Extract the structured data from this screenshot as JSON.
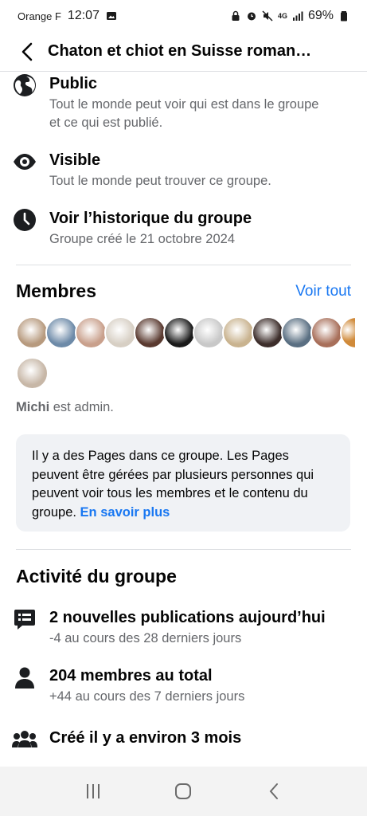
{
  "status_bar": {
    "carrier": "Orange F",
    "time": "12:07",
    "network": "4G",
    "battery": "69%"
  },
  "header": {
    "title": "Chaton et chiot en Suisse roman…"
  },
  "info": [
    {
      "icon": "globe-icon",
      "title": "Public",
      "sub": "Tout le monde peut voir qui est dans le groupe et ce qui est publié."
    },
    {
      "icon": "eye-icon",
      "title": "Visible",
      "sub": "Tout le monde peut trouver ce groupe."
    },
    {
      "icon": "clock-icon",
      "title": "Voir l’historique du groupe",
      "sub": "Groupe créé le 21 octobre 2024"
    }
  ],
  "members": {
    "title": "Membres",
    "see_all": "Voir tout",
    "admin_name": "Michi",
    "admin_suffix": " est admin.",
    "avatar_colors": [
      "#b79a7e",
      "#6d8aa8",
      "#c9a08c",
      "#d7cfc4",
      "#5a3a30",
      "#1b1b1b",
      "#c8c8c8",
      "#c9b38f",
      "#3d2e2b",
      "#5a6f82",
      "#a86f5a",
      "#d08a3a",
      "#c7b7a7"
    ]
  },
  "pages_box": {
    "text": "Il y a des Pages dans ce groupe. Les Pages peuvent être gérées par plusieurs personnes qui peuvent voir tous les membres et le contenu du groupe. ",
    "link": "En savoir plus"
  },
  "activity": {
    "title": "Activité du groupe",
    "items": [
      {
        "icon": "chat-icon",
        "title": "2 nouvelles publications aujourd’hui",
        "sub": "-4 au cours des 28 derniers jours"
      },
      {
        "icon": "person-icon",
        "title": "204 membres au total",
        "sub": "+44 au cours des 7 derniers jours"
      },
      {
        "icon": "group-icon",
        "title": "Créé il y a environ 3 mois",
        "sub": ""
      }
    ]
  },
  "colors": {
    "accent": "#1877f2",
    "secondary_text": "#65676b",
    "box_bg": "#f0f2f5"
  }
}
